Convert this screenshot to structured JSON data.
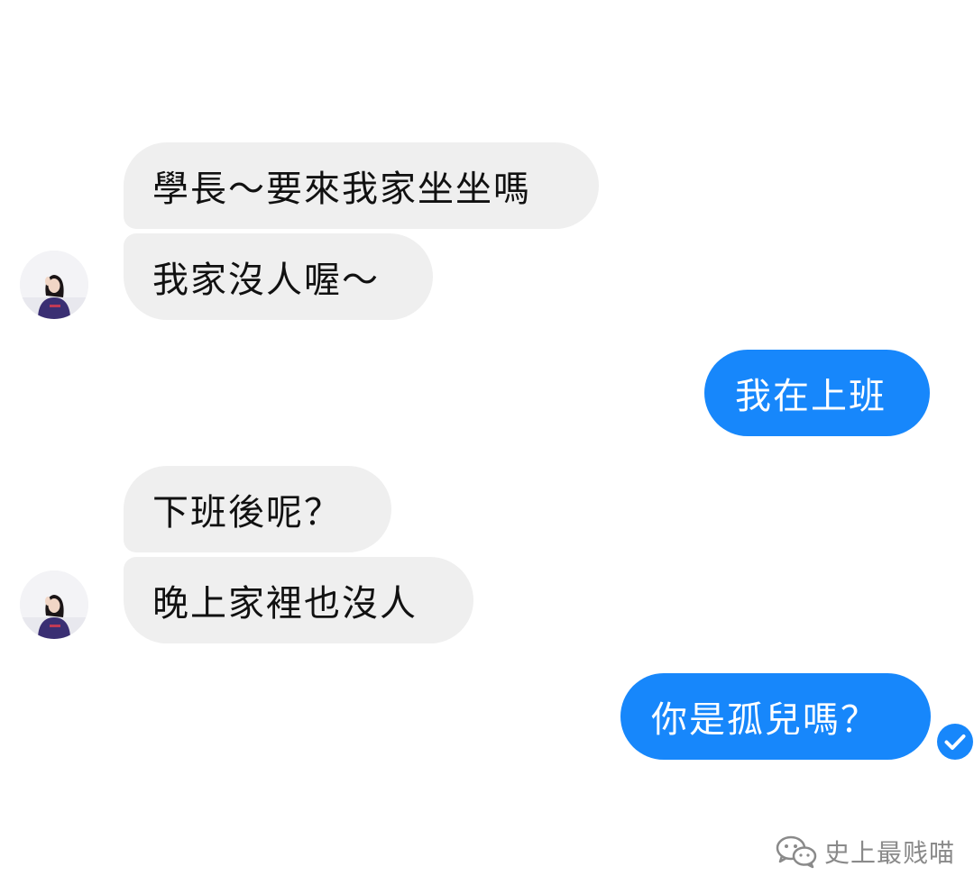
{
  "conversation": {
    "messages": [
      {
        "sender": "other",
        "text": "學長～要來我家坐坐嗎"
      },
      {
        "sender": "other",
        "text": "我家沒人喔～"
      },
      {
        "sender": "self",
        "text": "我在上班"
      },
      {
        "sender": "other",
        "text": "下班後呢？"
      },
      {
        "sender": "other",
        "text": "晚上家裡也沒人"
      },
      {
        "sender": "self",
        "text": "你是孤兒嗎？"
      }
    ]
  },
  "icons": {
    "avatar": "profile-photo",
    "read_receipt": "check-circle-icon",
    "watermark_logo": "wechat-logo"
  },
  "watermark": {
    "text": "史上最贱喵"
  },
  "colors": {
    "background": "#ffffff",
    "incoming_bubble": "#efefef",
    "outgoing_bubble": "#1787fb",
    "incoming_text": "#111111",
    "outgoing_text": "#ffffff",
    "watermark": "#8a8a8a"
  }
}
